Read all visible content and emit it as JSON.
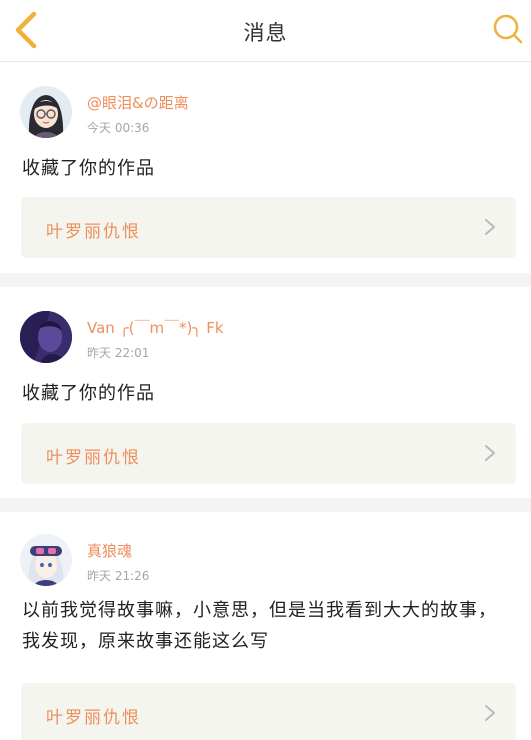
{
  "header": {
    "title": "消息",
    "back_icon": "chevron-left-icon",
    "search_icon": "search-icon",
    "accent_color": "#f0b13c"
  },
  "notifications": [
    {
      "username": "@眼泪&の距离",
      "time": "今天 00:36",
      "message": "收藏了你的作品",
      "work_title": "叶罗丽仇恨"
    },
    {
      "username": "Van ╭(￣m￣*)╮ Fk",
      "time": "昨天 22:01",
      "message": "收藏了你的作品",
      "work_title": "叶罗丽仇恨"
    },
    {
      "username": "真狼魂",
      "time": "昨天 21:26",
      "message": "以前我觉得故事嘛，小意思，但是当我看到大大的故事，我发现，原来故事还能这么写",
      "work_title": "叶罗丽仇恨"
    }
  ],
  "colors": {
    "username": "#ee8f5b",
    "work_title": "#ee8f5b",
    "link_background": "#f5f5f0"
  }
}
